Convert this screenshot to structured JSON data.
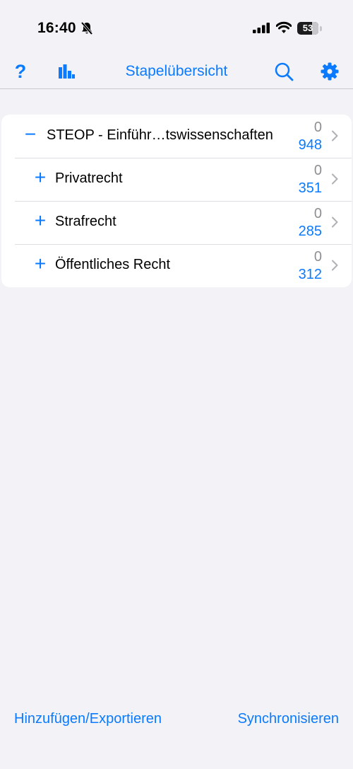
{
  "status_bar": {
    "time": "16:40",
    "battery": "53",
    "icons": [
      "bell-slash-icon",
      "signal-icon",
      "wifi-icon",
      "battery-icon"
    ]
  },
  "nav": {
    "title": "Stapelübersicht",
    "help_glyph": "?",
    "icons": [
      "help-icon",
      "stats-icon",
      "search-icon",
      "gear-icon"
    ],
    "accent_color": "#0a7aff"
  },
  "decks": [
    {
      "toggle": "−",
      "name": "STEOP - Einführ…tswissenschaften",
      "due": "0",
      "new": "948"
    },
    {
      "toggle": "+",
      "name": "Privatrecht",
      "due": "0",
      "new": "351"
    },
    {
      "toggle": "+",
      "name": "Strafrecht",
      "due": "0",
      "new": "285"
    },
    {
      "toggle": "+",
      "name": "Öffentliches Recht",
      "due": "0",
      "new": "312"
    }
  ],
  "bottom": {
    "add_export": "Hinzufügen/Exportieren",
    "sync": "Synchronisieren"
  }
}
